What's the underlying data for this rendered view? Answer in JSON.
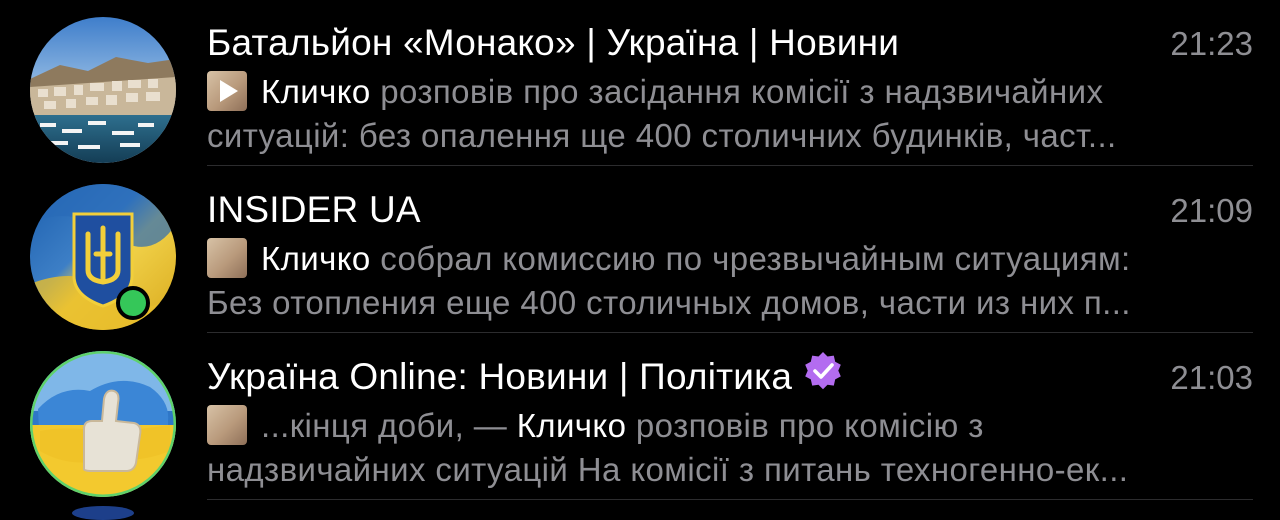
{
  "chats": [
    {
      "title": "Батальйон «Монако» | Україна | Новини",
      "time": "21:23",
      "avatar_icon": "monaco-harbor-photo",
      "preview_media_icon": "video-thumbnail-icon",
      "preview_line1_highlight": "Кличко",
      "preview_line1_rest": " розповів про засідання комісії з надзвичайних",
      "preview_line2": "ситуацій: без опалення ще 400 столичних будинків, част..."
    },
    {
      "title": "INSIDER UA",
      "time": "21:09",
      "avatar_icon": "ukraine-trident-flag-avatar",
      "online": true,
      "preview_media_icon": "video-thumbnail-icon",
      "preview_line1_highlight": "Кличко",
      "preview_line1_rest": " собрал комиссию по чрезвычайным ситуациям:",
      "preview_line2": "Без отопления еще 400 столичных домов, части из них п..."
    },
    {
      "title": "Україна Online: Новини | Політика",
      "time": "21:03",
      "verified": true,
      "verified_color": "#b36cf0",
      "avatar_icon": "thumbs-up-ukraine-map-avatar",
      "preview_media_icon": "video-thumbnail-icon",
      "preview_line1_prefix": "...кінця доби, — ",
      "preview_line1_highlight": "Кличко",
      "preview_line1_rest": " розповів про комісію з",
      "preview_line2": "надзвичайних ситуацій На комісії з питань техногенно-ек..."
    }
  ],
  "colors": {
    "background": "#000000",
    "title": "#ffffff",
    "secondary_text": "#8e8e93",
    "separator": "#2c2c2e",
    "online_dot": "#35c759"
  }
}
